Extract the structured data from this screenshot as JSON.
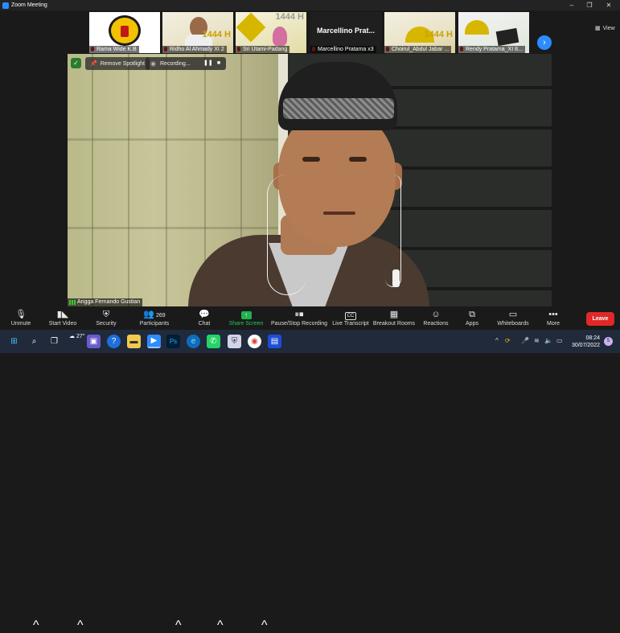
{
  "window": {
    "title": "Zoom Meeting"
  },
  "gallery": {
    "thumbnails": [
      {
        "name": "Rama Wide K.B",
        "kind": "logo"
      },
      {
        "name": "Ridho Al Ahmady XI 2",
        "kind": "poster",
        "poster_text": "1444 H"
      },
      {
        "name": "Sri Utami-Padang",
        "kind": "poster",
        "poster_text": "1444 H"
      },
      {
        "name": "Marcellino Pratama x3",
        "kind": "name",
        "display": "Marcellino  Prat..."
      },
      {
        "name": "Choirul_Abdul Jabar ...",
        "kind": "poster",
        "poster_text": "1444 H"
      },
      {
        "name": "Rendy Pratama_XI 8...",
        "kind": "poster",
        "poster_text": ""
      }
    ],
    "view_label": "View"
  },
  "spotlight": {
    "remove_label": "Remove Spotlight",
    "recording_label": "Recording...",
    "speaker_name": "Angga Fernando Gustian"
  },
  "toolbar": {
    "unmute": "Unmute",
    "start_video": "Start Video",
    "security": "Security",
    "participants": "Participants",
    "participant_count": "269",
    "chat": "Chat",
    "share_screen": "Share Screen",
    "pause_recording": "Pause/Stop Recording",
    "live_transcript": "Live Transcript",
    "cc": "CC",
    "breakout_rooms": "Breakout Rooms",
    "reactions": "Reactions",
    "apps": "Apps",
    "whiteboards": "Whiteboards",
    "more": "More",
    "leave": "Leave"
  },
  "taskbar": {
    "weather": "27°",
    "time": "08:24",
    "date": "30/07/2022",
    "notifications": "5"
  },
  "colors": {
    "accent": "#2d8cff",
    "leave": "#e02828",
    "share": "#22b14c"
  }
}
